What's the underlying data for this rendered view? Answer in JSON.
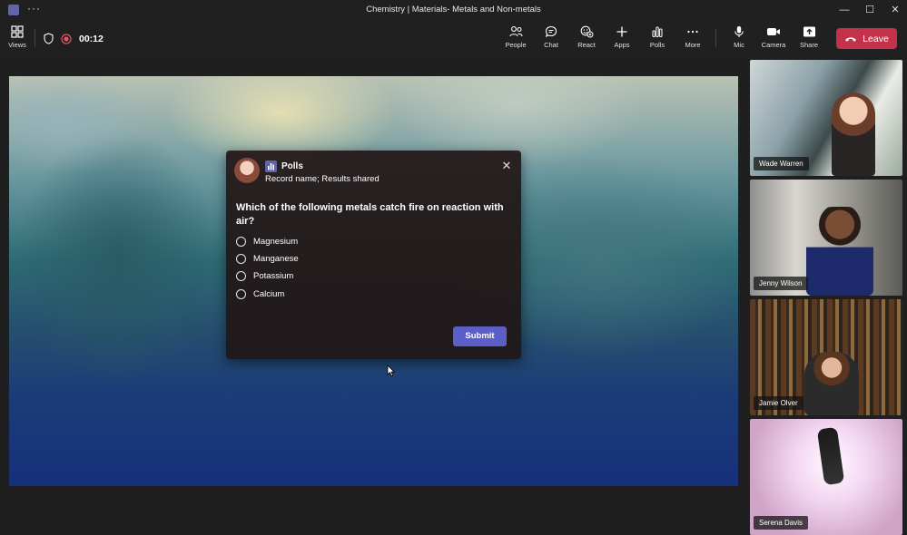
{
  "window": {
    "title": "Chemistry | Materials- Metals and Non-metals",
    "controls": [
      "minimize-icon",
      "maximize-icon",
      "close-icon"
    ]
  },
  "toolbar": {
    "views_label": "Views",
    "timer": "00:12",
    "buttons": [
      {
        "label": "People",
        "icon": "people-icon"
      },
      {
        "label": "Chat",
        "icon": "chat-icon"
      },
      {
        "label": "React",
        "icon": "react-icon"
      },
      {
        "label": "Apps",
        "icon": "apps-icon"
      },
      {
        "label": "Polls",
        "icon": "polls-icon"
      },
      {
        "label": "More",
        "icon": "more-icon"
      },
      {
        "label": "Mic",
        "icon": "mic-icon"
      },
      {
        "label": "Camera",
        "icon": "camera-icon"
      },
      {
        "label": "Share",
        "icon": "share-icon"
      }
    ],
    "leave_label": "Leave",
    "leave_color": "#c4314b"
  },
  "poll": {
    "app_name": "Polls",
    "subtitle": "Record name; Results shared",
    "question": "Which of the following metals catch fire on reaction with air?",
    "options": [
      "Magnesium",
      "Manganese",
      "Potassium",
      "Calcium"
    ],
    "submit_label": "Submit",
    "accent": "#5b5fc7"
  },
  "participants": [
    {
      "name": "Wade Warren"
    },
    {
      "name": "Jenny Wilson"
    },
    {
      "name": "Jamie Olver"
    },
    {
      "name": "Serena Davis"
    }
  ]
}
